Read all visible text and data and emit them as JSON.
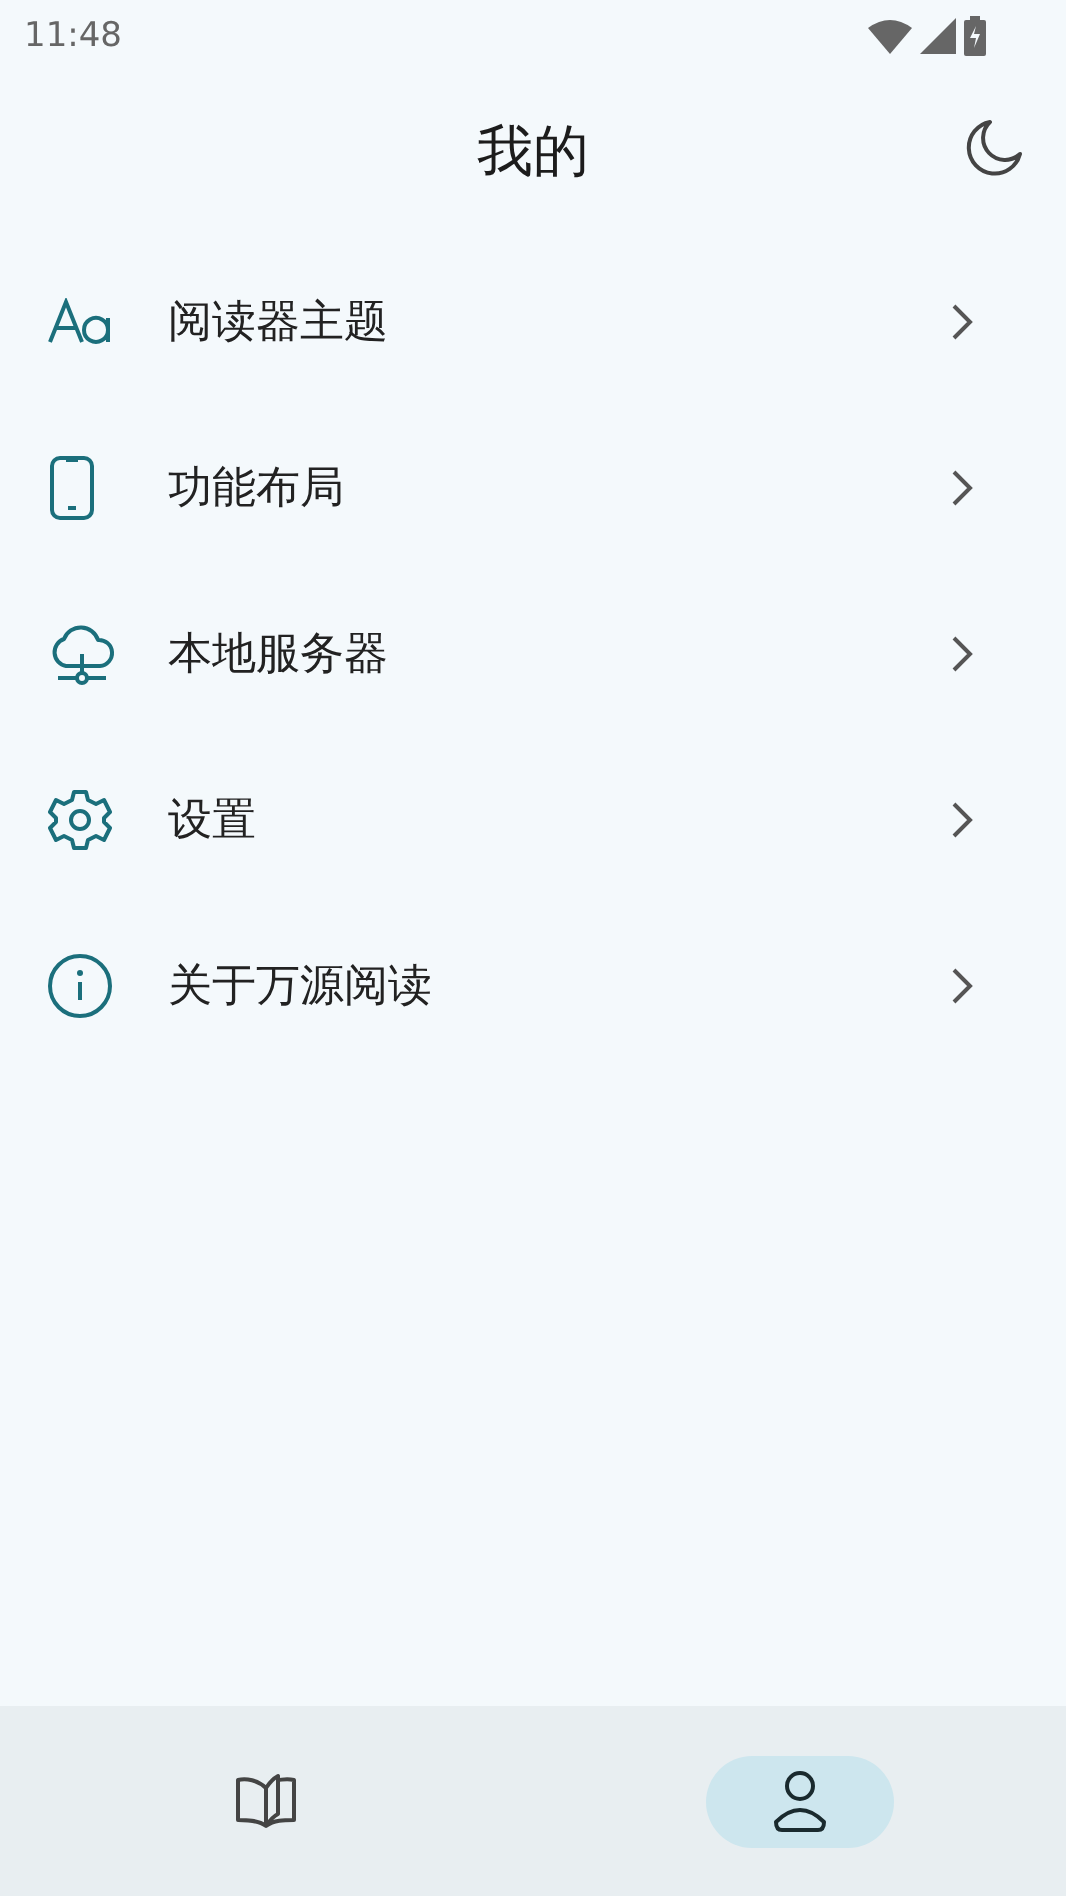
{
  "status_bar": {
    "time": "11:48"
  },
  "header": {
    "title": "我的"
  },
  "menu": [
    {
      "kind": "theme",
      "label": "阅读器主题"
    },
    {
      "kind": "phone",
      "label": "功能布局"
    },
    {
      "kind": "cloud",
      "label": "本地服务器"
    },
    {
      "kind": "gear",
      "label": "设置"
    },
    {
      "kind": "info",
      "label": "关于万源阅读"
    }
  ],
  "bottom_nav": [
    {
      "kind": "book",
      "selected": false
    },
    {
      "kind": "person",
      "selected": true
    }
  ]
}
